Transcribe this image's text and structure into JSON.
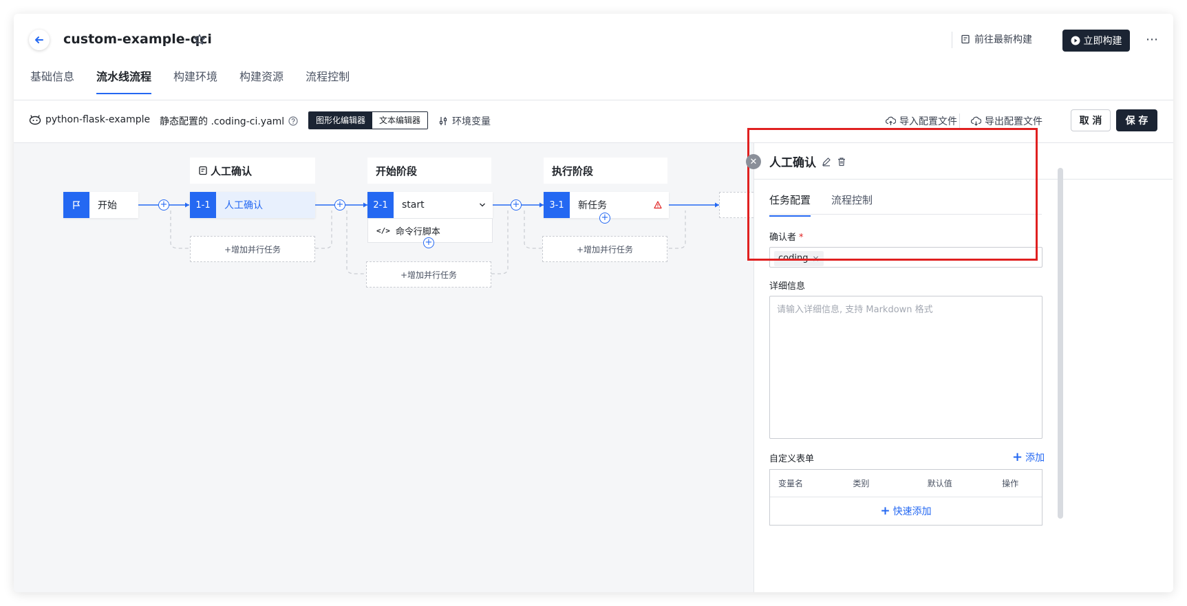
{
  "header": {
    "title": "custom-example-qci",
    "goto_latest": "前往最新构建",
    "build_now": "立即构建",
    "more": "⋯",
    "tabs": [
      "基础信息",
      "流水线流程",
      "构建环境",
      "构建资源",
      "流程控制"
    ],
    "active_tab": "流水线流程"
  },
  "toolbar": {
    "repo": "python-flask-example",
    "static_config": "静态配置的 .coding-ci.yaml",
    "graph_editor": "图形化编辑器",
    "text_editor": "文本编辑器",
    "env_vars": "环境变量",
    "import_cfg": "导入配置文件",
    "export_cfg": "导出配置文件",
    "cancel": "取 消",
    "save": "保 存"
  },
  "pipeline": {
    "start_label": "开始",
    "stages": [
      {
        "title": "人工确认",
        "task_index": "1-1",
        "task_name": "人工确认",
        "add_parallel": "+增加并行任务"
      },
      {
        "title": "开始阶段",
        "task_index": "2-1",
        "task_name": "start",
        "subtask": "命令行脚本",
        "add_parallel": "+增加并行任务"
      },
      {
        "title": "执行阶段",
        "task_index": "3-1",
        "task_name": "新任务",
        "add_parallel": "+增加并行任务"
      }
    ]
  },
  "panel": {
    "title": "人工确认",
    "tabs": [
      "任务配置",
      "流程控制"
    ],
    "confirmer_label": "确认者",
    "required_mark": "*",
    "confirmer_tag": "coding",
    "detail_label": "详细信息",
    "detail_placeholder": "请输入详细信息, 支持 Markdown 格式",
    "custom_form_label": "自定义表单",
    "add": "添加",
    "table_headers": [
      "变量名",
      "类别",
      "默认值",
      "操作"
    ],
    "quick_add": "快速添加"
  },
  "colors": {
    "accent": "#2468f2",
    "dark": "#1b2433",
    "highlight": "#e02020"
  }
}
